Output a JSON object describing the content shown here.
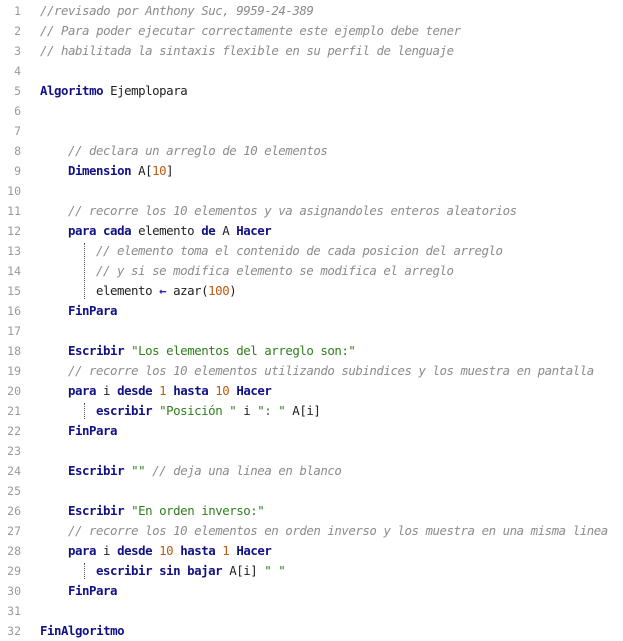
{
  "editor": {
    "lines": [
      {
        "n": "1",
        "indent": 0,
        "tokens": [
          {
            "c": "cm",
            "t": "//revisado por Anthony Suc, 9959-24-389"
          }
        ]
      },
      {
        "n": "2",
        "indent": 0,
        "tokens": [
          {
            "c": "cm",
            "t": "// Para poder ejecutar correctamente este ejemplo debe tener"
          }
        ]
      },
      {
        "n": "3",
        "indent": 0,
        "tokens": [
          {
            "c": "cm",
            "t": "// habilitada la sintaxis flexible en su perfil de lenguaje"
          }
        ]
      },
      {
        "n": "4",
        "indent": 0,
        "tokens": []
      },
      {
        "n": "5",
        "indent": 0,
        "tokens": [
          {
            "c": "kw",
            "t": "Algoritmo"
          },
          {
            "c": "id",
            "t": " Ejemplopara"
          }
        ]
      },
      {
        "n": "6",
        "indent": 0,
        "tokens": []
      },
      {
        "n": "7",
        "indent": 0,
        "tokens": []
      },
      {
        "n": "8",
        "indent": 1,
        "tokens": [
          {
            "c": "cm",
            "t": "// declara un arreglo de 10 elementos"
          }
        ]
      },
      {
        "n": "9",
        "indent": 1,
        "tokens": [
          {
            "c": "kw",
            "t": "Dimension"
          },
          {
            "c": "id",
            "t": " A["
          },
          {
            "c": "num",
            "t": "10"
          },
          {
            "c": "id",
            "t": "]"
          }
        ]
      },
      {
        "n": "10",
        "indent": 0,
        "tokens": []
      },
      {
        "n": "11",
        "indent": 1,
        "tokens": [
          {
            "c": "cm",
            "t": "// recorre los 10 elementos y va asignandoles enteros aleatorios"
          }
        ]
      },
      {
        "n": "12",
        "indent": 1,
        "tokens": [
          {
            "c": "kw",
            "t": "para cada"
          },
          {
            "c": "id",
            "t": " elemento "
          },
          {
            "c": "kw",
            "t": "de"
          },
          {
            "c": "id",
            "t": " A "
          },
          {
            "c": "kw",
            "t": "Hacer"
          }
        ]
      },
      {
        "n": "13",
        "indent": 2,
        "tokens": [
          {
            "c": "cm",
            "t": "// elemento toma el contenido de cada posicion del arreglo"
          }
        ]
      },
      {
        "n": "14",
        "indent": 2,
        "tokens": [
          {
            "c": "cm",
            "t": "// y si se modifica elemento se modifica el arreglo"
          }
        ]
      },
      {
        "n": "15",
        "indent": 2,
        "tokens": [
          {
            "c": "id",
            "t": "elemento "
          },
          {
            "c": "op",
            "t": "←"
          },
          {
            "c": "id",
            "t": " azar("
          },
          {
            "c": "num",
            "t": "100"
          },
          {
            "c": "id",
            "t": ")"
          }
        ]
      },
      {
        "n": "16",
        "indent": 1,
        "tokens": [
          {
            "c": "kw",
            "t": "FinPara"
          }
        ]
      },
      {
        "n": "17",
        "indent": 0,
        "tokens": []
      },
      {
        "n": "18",
        "indent": 1,
        "tokens": [
          {
            "c": "kw",
            "t": "Escribir"
          },
          {
            "c": "id",
            "t": " "
          },
          {
            "c": "st",
            "t": "\"Los elementos del arreglo son:\""
          }
        ]
      },
      {
        "n": "19",
        "indent": 1,
        "tokens": [
          {
            "c": "cm",
            "t": "// recorre los 10 elementos utilizando subindices y los muestra en pantalla"
          }
        ]
      },
      {
        "n": "20",
        "indent": 1,
        "tokens": [
          {
            "c": "kw",
            "t": "para"
          },
          {
            "c": "id",
            "t": " i "
          },
          {
            "c": "kw",
            "t": "desde"
          },
          {
            "c": "id",
            "t": " "
          },
          {
            "c": "num",
            "t": "1"
          },
          {
            "c": "id",
            "t": " "
          },
          {
            "c": "kw",
            "t": "hasta"
          },
          {
            "c": "id",
            "t": " "
          },
          {
            "c": "num",
            "t": "10"
          },
          {
            "c": "id",
            "t": " "
          },
          {
            "c": "kw",
            "t": "Hacer"
          }
        ]
      },
      {
        "n": "21",
        "indent": 2,
        "tokens": [
          {
            "c": "kw",
            "t": "escribir"
          },
          {
            "c": "id",
            "t": " "
          },
          {
            "c": "st",
            "t": "\"Posición \""
          },
          {
            "c": "id",
            "t": " i "
          },
          {
            "c": "st",
            "t": "\": \""
          },
          {
            "c": "id",
            "t": " A[i]"
          }
        ]
      },
      {
        "n": "22",
        "indent": 1,
        "tokens": [
          {
            "c": "kw",
            "t": "FinPara"
          }
        ]
      },
      {
        "n": "23",
        "indent": 0,
        "tokens": []
      },
      {
        "n": "24",
        "indent": 1,
        "tokens": [
          {
            "c": "kw",
            "t": "Escribir"
          },
          {
            "c": "id",
            "t": " "
          },
          {
            "c": "st",
            "t": "\"\""
          },
          {
            "c": "id",
            "t": " "
          },
          {
            "c": "cm",
            "t": "// deja una linea en blanco"
          }
        ]
      },
      {
        "n": "25",
        "indent": 0,
        "tokens": []
      },
      {
        "n": "26",
        "indent": 1,
        "tokens": [
          {
            "c": "kw",
            "t": "Escribir"
          },
          {
            "c": "id",
            "t": " "
          },
          {
            "c": "st",
            "t": "\"En orden inverso:\""
          }
        ]
      },
      {
        "n": "27",
        "indent": 1,
        "tokens": [
          {
            "c": "cm",
            "t": "// recorre los 10 elementos en orden inverso y los muestra en una misma linea"
          }
        ]
      },
      {
        "n": "28",
        "indent": 1,
        "tokens": [
          {
            "c": "kw",
            "t": "para"
          },
          {
            "c": "id",
            "t": " i "
          },
          {
            "c": "kw",
            "t": "desde"
          },
          {
            "c": "id",
            "t": " "
          },
          {
            "c": "num",
            "t": "10"
          },
          {
            "c": "id",
            "t": " "
          },
          {
            "c": "kw",
            "t": "hasta"
          },
          {
            "c": "id",
            "t": " "
          },
          {
            "c": "num",
            "t": "1"
          },
          {
            "c": "id",
            "t": " "
          },
          {
            "c": "kw",
            "t": "Hacer"
          }
        ]
      },
      {
        "n": "29",
        "indent": 2,
        "tokens": [
          {
            "c": "kw",
            "t": "escribir sin bajar"
          },
          {
            "c": "id",
            "t": " A[i] "
          },
          {
            "c": "st",
            "t": "\" \""
          }
        ]
      },
      {
        "n": "30",
        "indent": 1,
        "tokens": [
          {
            "c": "kw",
            "t": "FinPara"
          }
        ]
      },
      {
        "n": "31",
        "indent": 0,
        "tokens": []
      },
      {
        "n": "32",
        "indent": 0,
        "tokens": [
          {
            "c": "kw",
            "t": "FinAlgoritmo"
          }
        ]
      }
    ]
  },
  "colors": {
    "keyword": "#111185",
    "comment": "#8c8c8c",
    "string": "#2e7d1c",
    "number": "#c05a10",
    "line_number": "#9a9a9a",
    "background": "#ffffff"
  }
}
